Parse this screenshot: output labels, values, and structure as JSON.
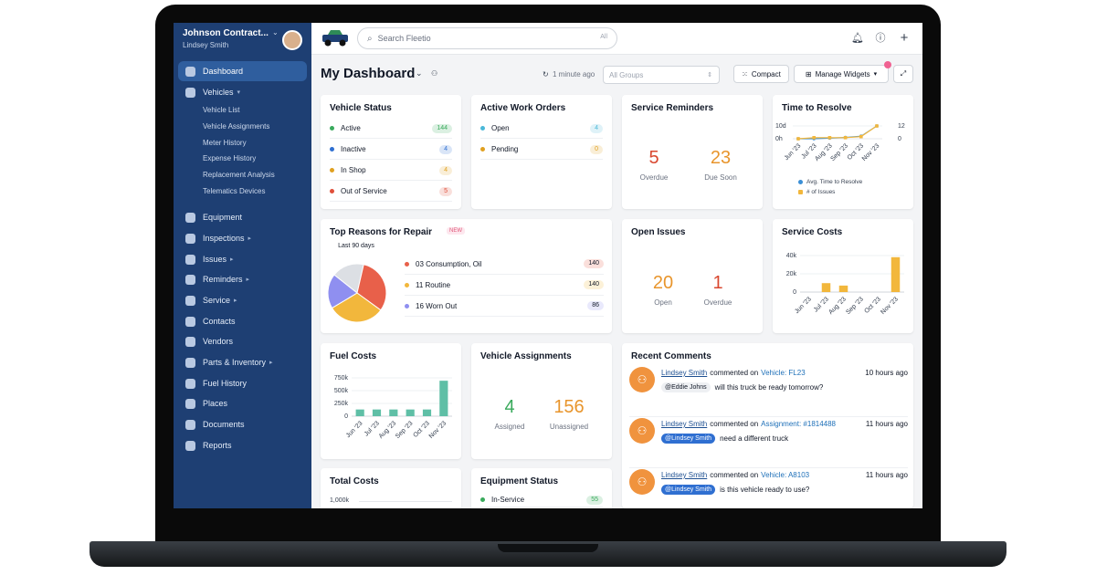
{
  "account": {
    "company": "Johnson Contract...",
    "user": "Lindsey Smith"
  },
  "nav": {
    "dashboard": "Dashboard",
    "vehicles": "Vehicles",
    "vehicles_sub": [
      "Vehicle List",
      "Vehicle Assignments",
      "Meter History",
      "Expense History",
      "Replacement Analysis",
      "Telematics Devices"
    ],
    "items": [
      "Equipment",
      "Inspections",
      "Issues",
      "Reminders",
      "Service",
      "Contacts",
      "Vendors",
      "Parts & Inventory",
      "Fuel History",
      "Places",
      "Documents",
      "Reports"
    ]
  },
  "search": {
    "placeholder": "Search Fleetio",
    "scope": "All"
  },
  "header": {
    "title": "My Dashboard",
    "updated": "1 minute ago",
    "groups": "All Groups",
    "compact": "Compact",
    "manage": "Manage Widgets"
  },
  "vehicle_status": {
    "title": "Vehicle Status",
    "rows": [
      {
        "label": "Active",
        "count": "144",
        "color": "#3aaa5c"
      },
      {
        "label": "Inactive",
        "count": "4",
        "color": "#2f6fd1"
      },
      {
        "label": "In Shop",
        "count": "4",
        "color": "#e0a020"
      },
      {
        "label": "Out of Service",
        "count": "5",
        "color": "#e04f3a"
      }
    ]
  },
  "work_orders": {
    "title": "Active Work Orders",
    "rows": [
      {
        "label": "Open",
        "count": "4",
        "color": "#4bb8d8"
      },
      {
        "label": "Pending",
        "count": "0",
        "color": "#e0a020"
      }
    ]
  },
  "service_reminders": {
    "title": "Service Reminders",
    "overdue": "5",
    "overdue_label": "Overdue",
    "due_soon": "23",
    "due_soon_label": "Due Soon"
  },
  "time_to_resolve": {
    "title": "Time to Resolve",
    "legend_avg": "Avg. Time to Resolve",
    "legend_issues": "# of Issues"
  },
  "top_reasons": {
    "title": "Top Reasons for Repair",
    "badge": "NEW",
    "center_label": "Last 90 days",
    "rows": [
      {
        "label": "03 Consumption, Oil",
        "count": "140",
        "color": "#e8604a"
      },
      {
        "label": "11 Routine",
        "count": "140",
        "color": "#f2b73c"
      },
      {
        "label": "16 Worn Out",
        "count": "86",
        "color": "#8f8ff0"
      }
    ]
  },
  "open_issues": {
    "title": "Open Issues",
    "open": "20",
    "open_label": "Open",
    "overdue": "1",
    "overdue_label": "Overdue"
  },
  "service_costs": {
    "title": "Service Costs"
  },
  "fuel_costs": {
    "title": "Fuel Costs"
  },
  "vehicle_assignments": {
    "title": "Vehicle Assignments",
    "assigned": "4",
    "assigned_label": "Assigned",
    "unassigned": "156",
    "unassigned_label": "Unassigned"
  },
  "recent_comments": {
    "title": "Recent Comments",
    "items": [
      {
        "user": "Lindsey Smith",
        "verb": "commented on",
        "target": "Vehicle: FL23",
        "time": "10 hours ago",
        "mention": "@Eddie Johns",
        "text": "will this truck be ready tomorrow?"
      },
      {
        "user": "Lindsey Smith",
        "verb": "commented on",
        "target": "Assignment: #1814488",
        "time": "11 hours ago",
        "mention": "@Lindsey Smith",
        "text": "need a different truck"
      },
      {
        "user": "Lindsey Smith",
        "verb": "commented on",
        "target": "Vehicle: A8103",
        "time": "11 hours ago",
        "mention": "@Lindsey Smith",
        "text": "is this vehicle ready to use?"
      }
    ]
  },
  "total_costs": {
    "title": "Total Costs"
  },
  "equipment_status": {
    "title": "Equipment Status",
    "rows": [
      {
        "label": "In-Service",
        "count": "55",
        "color": "#3aaa5c"
      }
    ]
  },
  "chart_data": [
    {
      "type": "line",
      "title": "Time to Resolve",
      "categories": [
        "Jun '23",
        "Jul '23",
        "Aug '23",
        "Sep '23",
        "Oct '23",
        "Nov '23"
      ],
      "y_left_ticks": [
        "10d",
        "0h"
      ],
      "y_right_ticks": [
        "12",
        "0"
      ],
      "series": [
        {
          "name": "Avg. Time to Resolve",
          "values": [
            0,
            0,
            0.5,
            1,
            2,
            10
          ],
          "color": "#3b8fd6"
        },
        {
          "name": "# of Issues",
          "values": [
            0,
            1,
            1,
            1,
            2,
            12
          ],
          "color": "#f2b73c"
        }
      ]
    },
    {
      "type": "pie",
      "title": "Top Reasons for Repair",
      "series": [
        {
          "name": "",
          "values": [
            {
              "label": "03 Consumption, Oil",
              "value": 140,
              "color": "#e8604a"
            },
            {
              "label": "11 Routine",
              "value": 140,
              "color": "#f2b73c"
            },
            {
              "label": "16 Worn Out",
              "value": 86,
              "color": "#8f8ff0"
            },
            {
              "label": "",
              "value": 80,
              "color": "#dcdfe4"
            }
          ]
        }
      ]
    },
    {
      "type": "bar",
      "title": "Service Costs",
      "categories": [
        "Jun '23",
        "Jul '23",
        "Aug '23",
        "Sep '23",
        "Oct '23",
        "Nov '23"
      ],
      "values": [
        0,
        11000,
        8000,
        0,
        0,
        43000
      ],
      "y_ticks": [
        "40k",
        "20k",
        "0"
      ],
      "ylim": [
        0,
        45000
      ],
      "color": "#f2b73c"
    },
    {
      "type": "bar",
      "title": "Fuel Costs",
      "categories": [
        "Jun '23",
        "Jul '23",
        "Aug '23",
        "Sep '23",
        "Oct '23",
        "Nov '23"
      ],
      "values": [
        140000,
        140000,
        140000,
        140000,
        140000,
        740000
      ],
      "y_ticks": [
        "750k",
        "500k",
        "250k",
        "0"
      ],
      "ylim": [
        0,
        800000
      ],
      "color": "#5fbfa6"
    },
    {
      "type": "bar",
      "title": "Total Costs",
      "y_ticks": [
        "1,000k"
      ],
      "categories": [],
      "values": []
    }
  ]
}
